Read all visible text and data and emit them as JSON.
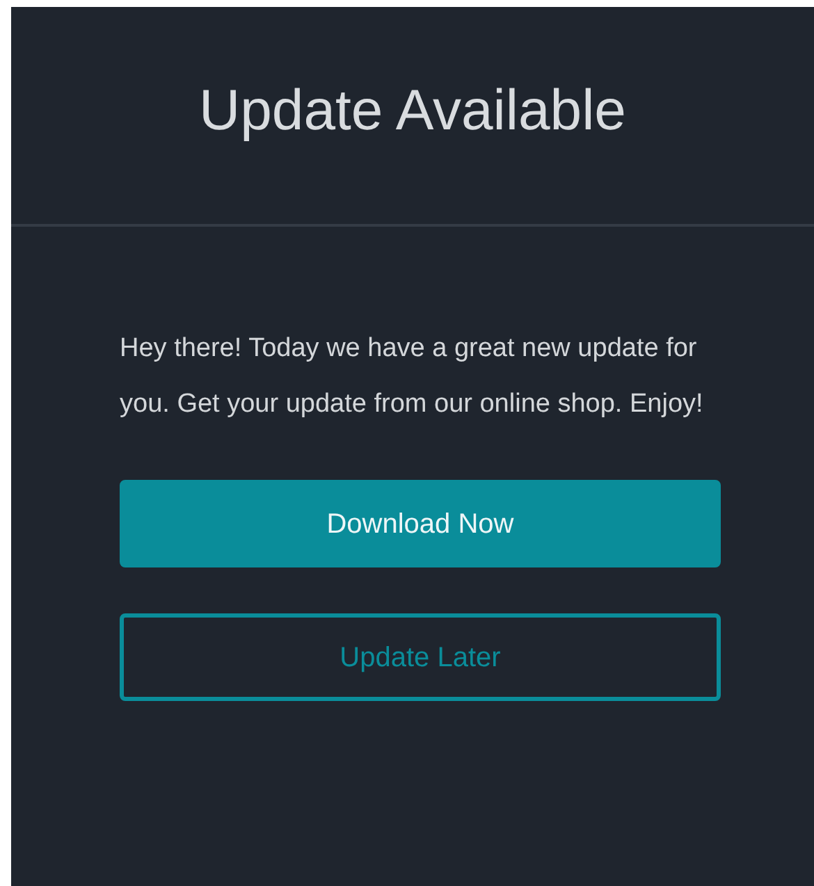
{
  "dialog": {
    "title": "Update Available",
    "message": "Hey there! Today we have a great new update for you. Get your update from our online shop. Enjoy!",
    "buttons": [
      {
        "label": "Download Now",
        "kind": "primary"
      },
      {
        "label": "Update Later",
        "kind": "outline"
      }
    ]
  }
}
